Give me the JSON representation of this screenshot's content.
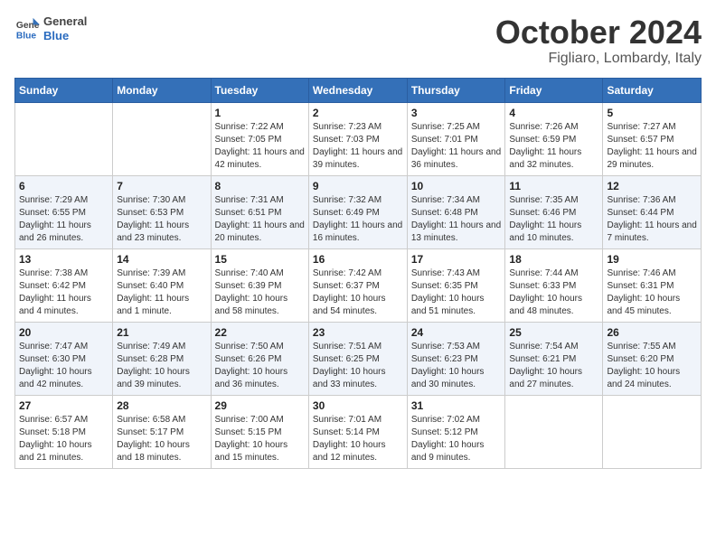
{
  "header": {
    "logo_general": "General",
    "logo_blue": "Blue",
    "month_title": "October 2024",
    "location": "Figliaro, Lombardy, Italy"
  },
  "columns": [
    "Sunday",
    "Monday",
    "Tuesday",
    "Wednesday",
    "Thursday",
    "Friday",
    "Saturday"
  ],
  "weeks": [
    [
      {
        "day": "",
        "sunrise": "",
        "sunset": "",
        "daylight": ""
      },
      {
        "day": "",
        "sunrise": "",
        "sunset": "",
        "daylight": ""
      },
      {
        "day": "1",
        "sunrise": "Sunrise: 7:22 AM",
        "sunset": "Sunset: 7:05 PM",
        "daylight": "Daylight: 11 hours and 42 minutes."
      },
      {
        "day": "2",
        "sunrise": "Sunrise: 7:23 AM",
        "sunset": "Sunset: 7:03 PM",
        "daylight": "Daylight: 11 hours and 39 minutes."
      },
      {
        "day": "3",
        "sunrise": "Sunrise: 7:25 AM",
        "sunset": "Sunset: 7:01 PM",
        "daylight": "Daylight: 11 hours and 36 minutes."
      },
      {
        "day": "4",
        "sunrise": "Sunrise: 7:26 AM",
        "sunset": "Sunset: 6:59 PM",
        "daylight": "Daylight: 11 hours and 32 minutes."
      },
      {
        "day": "5",
        "sunrise": "Sunrise: 7:27 AM",
        "sunset": "Sunset: 6:57 PM",
        "daylight": "Daylight: 11 hours and 29 minutes."
      }
    ],
    [
      {
        "day": "6",
        "sunrise": "Sunrise: 7:29 AM",
        "sunset": "Sunset: 6:55 PM",
        "daylight": "Daylight: 11 hours and 26 minutes."
      },
      {
        "day": "7",
        "sunrise": "Sunrise: 7:30 AM",
        "sunset": "Sunset: 6:53 PM",
        "daylight": "Daylight: 11 hours and 23 minutes."
      },
      {
        "day": "8",
        "sunrise": "Sunrise: 7:31 AM",
        "sunset": "Sunset: 6:51 PM",
        "daylight": "Daylight: 11 hours and 20 minutes."
      },
      {
        "day": "9",
        "sunrise": "Sunrise: 7:32 AM",
        "sunset": "Sunset: 6:49 PM",
        "daylight": "Daylight: 11 hours and 16 minutes."
      },
      {
        "day": "10",
        "sunrise": "Sunrise: 7:34 AM",
        "sunset": "Sunset: 6:48 PM",
        "daylight": "Daylight: 11 hours and 13 minutes."
      },
      {
        "day": "11",
        "sunrise": "Sunrise: 7:35 AM",
        "sunset": "Sunset: 6:46 PM",
        "daylight": "Daylight: 11 hours and 10 minutes."
      },
      {
        "day": "12",
        "sunrise": "Sunrise: 7:36 AM",
        "sunset": "Sunset: 6:44 PM",
        "daylight": "Daylight: 11 hours and 7 minutes."
      }
    ],
    [
      {
        "day": "13",
        "sunrise": "Sunrise: 7:38 AM",
        "sunset": "Sunset: 6:42 PM",
        "daylight": "Daylight: 11 hours and 4 minutes."
      },
      {
        "day": "14",
        "sunrise": "Sunrise: 7:39 AM",
        "sunset": "Sunset: 6:40 PM",
        "daylight": "Daylight: 11 hours and 1 minute."
      },
      {
        "day": "15",
        "sunrise": "Sunrise: 7:40 AM",
        "sunset": "Sunset: 6:39 PM",
        "daylight": "Daylight: 10 hours and 58 minutes."
      },
      {
        "day": "16",
        "sunrise": "Sunrise: 7:42 AM",
        "sunset": "Sunset: 6:37 PM",
        "daylight": "Daylight: 10 hours and 54 minutes."
      },
      {
        "day": "17",
        "sunrise": "Sunrise: 7:43 AM",
        "sunset": "Sunset: 6:35 PM",
        "daylight": "Daylight: 10 hours and 51 minutes."
      },
      {
        "day": "18",
        "sunrise": "Sunrise: 7:44 AM",
        "sunset": "Sunset: 6:33 PM",
        "daylight": "Daylight: 10 hours and 48 minutes."
      },
      {
        "day": "19",
        "sunrise": "Sunrise: 7:46 AM",
        "sunset": "Sunset: 6:31 PM",
        "daylight": "Daylight: 10 hours and 45 minutes."
      }
    ],
    [
      {
        "day": "20",
        "sunrise": "Sunrise: 7:47 AM",
        "sunset": "Sunset: 6:30 PM",
        "daylight": "Daylight: 10 hours and 42 minutes."
      },
      {
        "day": "21",
        "sunrise": "Sunrise: 7:49 AM",
        "sunset": "Sunset: 6:28 PM",
        "daylight": "Daylight: 10 hours and 39 minutes."
      },
      {
        "day": "22",
        "sunrise": "Sunrise: 7:50 AM",
        "sunset": "Sunset: 6:26 PM",
        "daylight": "Daylight: 10 hours and 36 minutes."
      },
      {
        "day": "23",
        "sunrise": "Sunrise: 7:51 AM",
        "sunset": "Sunset: 6:25 PM",
        "daylight": "Daylight: 10 hours and 33 minutes."
      },
      {
        "day": "24",
        "sunrise": "Sunrise: 7:53 AM",
        "sunset": "Sunset: 6:23 PM",
        "daylight": "Daylight: 10 hours and 30 minutes."
      },
      {
        "day": "25",
        "sunrise": "Sunrise: 7:54 AM",
        "sunset": "Sunset: 6:21 PM",
        "daylight": "Daylight: 10 hours and 27 minutes."
      },
      {
        "day": "26",
        "sunrise": "Sunrise: 7:55 AM",
        "sunset": "Sunset: 6:20 PM",
        "daylight": "Daylight: 10 hours and 24 minutes."
      }
    ],
    [
      {
        "day": "27",
        "sunrise": "Sunrise: 6:57 AM",
        "sunset": "Sunset: 5:18 PM",
        "daylight": "Daylight: 10 hours and 21 minutes."
      },
      {
        "day": "28",
        "sunrise": "Sunrise: 6:58 AM",
        "sunset": "Sunset: 5:17 PM",
        "daylight": "Daylight: 10 hours and 18 minutes."
      },
      {
        "day": "29",
        "sunrise": "Sunrise: 7:00 AM",
        "sunset": "Sunset: 5:15 PM",
        "daylight": "Daylight: 10 hours and 15 minutes."
      },
      {
        "day": "30",
        "sunrise": "Sunrise: 7:01 AM",
        "sunset": "Sunset: 5:14 PM",
        "daylight": "Daylight: 10 hours and 12 minutes."
      },
      {
        "day": "31",
        "sunrise": "Sunrise: 7:02 AM",
        "sunset": "Sunset: 5:12 PM",
        "daylight": "Daylight: 10 hours and 9 minutes."
      },
      {
        "day": "",
        "sunrise": "",
        "sunset": "",
        "daylight": ""
      },
      {
        "day": "",
        "sunrise": "",
        "sunset": "",
        "daylight": ""
      }
    ]
  ]
}
